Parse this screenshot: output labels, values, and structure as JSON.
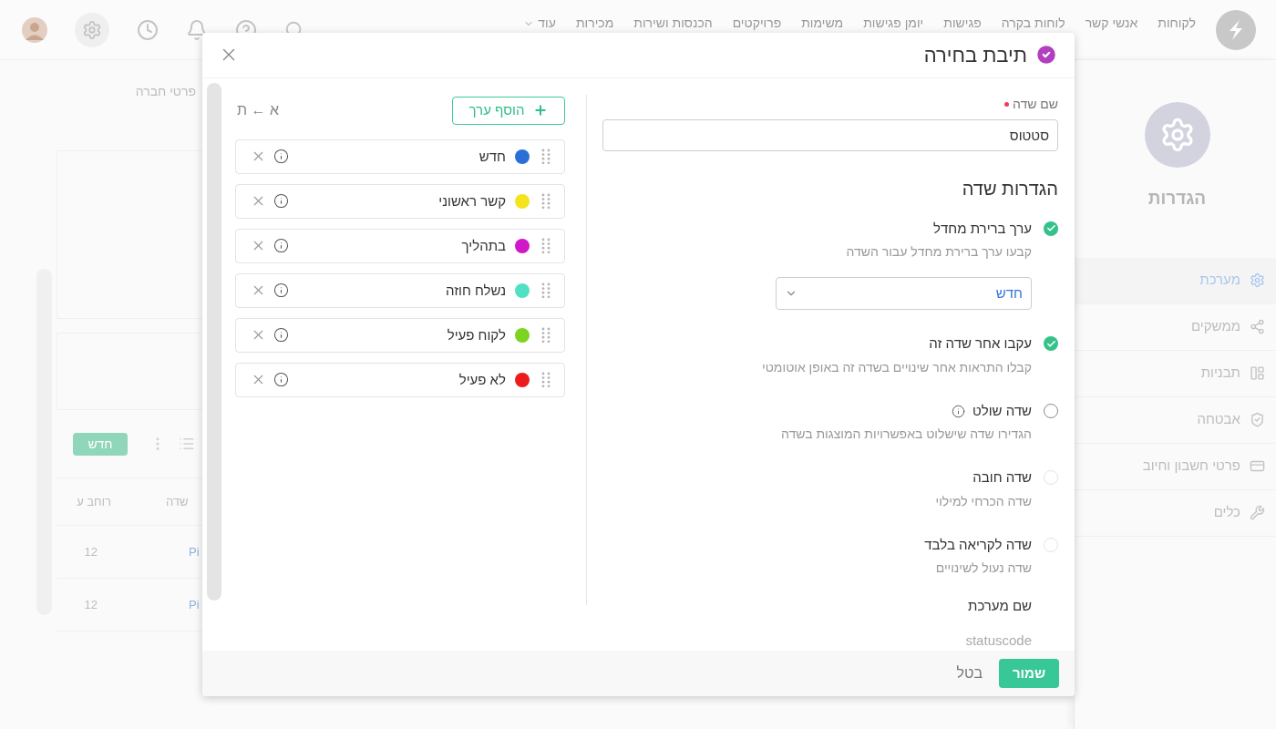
{
  "top_nav": {
    "items": [
      {
        "label": "לקוחות"
      },
      {
        "label": "אנשי קשר"
      },
      {
        "label": "לוחות בקרה"
      },
      {
        "label": "פגישות"
      },
      {
        "label": "יומן פגישות"
      },
      {
        "label": "משימות"
      },
      {
        "label": "פרויקטים"
      },
      {
        "label": "הכנסות ושירות"
      },
      {
        "label": "מכירות"
      }
    ],
    "more": "עוד"
  },
  "page_title": "פרטי חברה",
  "background_table": {
    "new_button": "חדש",
    "columns": [
      "שדה",
      "רוחב ע"
    ],
    "rows": [
      {
        "cells": [
          "Pi",
          "12"
        ]
      },
      {
        "cells": [
          "Pi",
          "12"
        ]
      }
    ]
  },
  "settings_sidebar": {
    "title": "הגדרות",
    "items": [
      {
        "label": "מערכת",
        "selected": true
      },
      {
        "label": "ממשקים",
        "selected": false
      },
      {
        "label": "תבניות",
        "selected": false
      },
      {
        "label": "אבטחה",
        "selected": false
      },
      {
        "label": "פרטי חשבון וחיוב",
        "selected": false
      },
      {
        "label": "כלים",
        "selected": false
      }
    ]
  },
  "dialog": {
    "title": "תיבת בחירה",
    "values_panel": {
      "add_button": "הוסף ערך",
      "sort_label": "א ← ת",
      "values": [
        {
          "label": "חדש",
          "color": "#2a6fd6"
        },
        {
          "label": "קשר ראשוני",
          "color": "#f5e31c"
        },
        {
          "label": "בתהליך",
          "color": "#d018c8"
        },
        {
          "label": "נשלח חוזה",
          "color": "#52e0c4"
        },
        {
          "label": "לקוח פעיל",
          "color": "#7ed321"
        },
        {
          "label": "לא פעיל",
          "color": "#ec1c1c"
        }
      ]
    },
    "field_name": {
      "label": "שם שדה",
      "required": true,
      "value": "סטטוס"
    },
    "settings_title": "הגדרות שדה",
    "options": [
      {
        "label": "ערך ברירת מחדל",
        "description": "קבעו ערך ברירת מחדל עבור השדה",
        "checked": true,
        "disabled": false,
        "info": false,
        "dropdown_value": "חדש"
      },
      {
        "label": "עקבו אחר שדה זה",
        "description": "קבלו התראות אחר שינויים בשדה זה באופן אוטומטי",
        "checked": true,
        "disabled": false,
        "info": false
      },
      {
        "label": "שדה שולט",
        "description": "הגדירו שדה שישלוט באפשרויות המוצגות בשדה",
        "checked": false,
        "disabled": false,
        "info": true
      },
      {
        "label": "שדה חובה",
        "description": "שדה הכרחי למילוי",
        "checked": false,
        "disabled": true,
        "info": false
      },
      {
        "label": "שדה לקריאה בלבד",
        "description": "שדה נעול לשינויים",
        "checked": false,
        "disabled": true,
        "info": false
      }
    ],
    "system_name": {
      "label": "שם מערכת",
      "value": "statuscode"
    },
    "buttons": {
      "cancel": "בטל",
      "save": "שמור"
    }
  }
}
